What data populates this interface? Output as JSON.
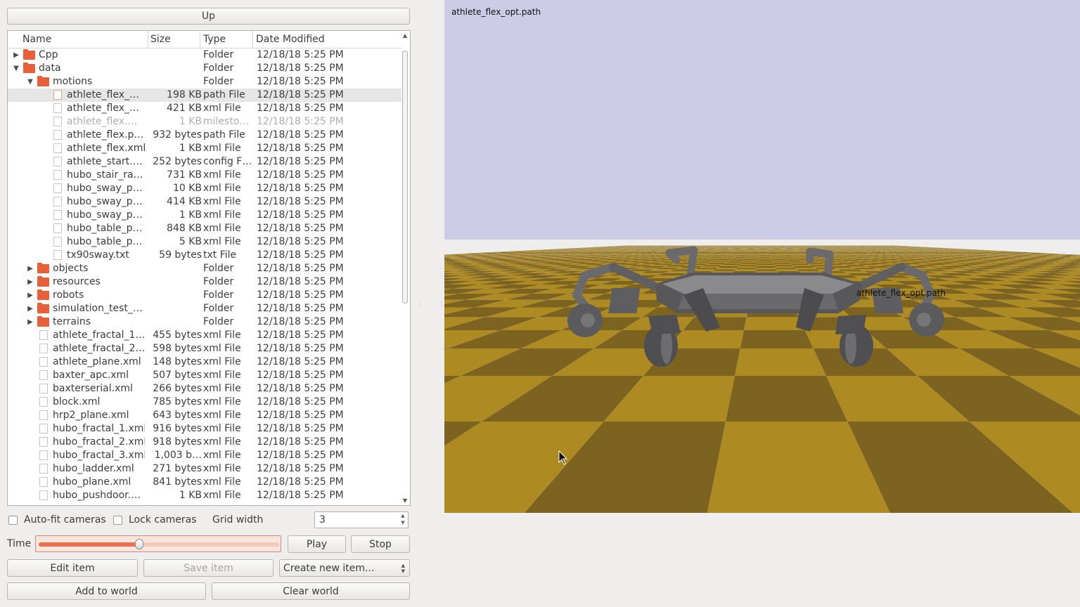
{
  "file_browser": {
    "up_label": "Up",
    "columns": [
      "Name",
      "Size",
      "Type",
      "Date Modified"
    ],
    "rows": [
      {
        "name": "Cpp",
        "size": "",
        "type": "Folder",
        "date": "12/18/18 5:25 PM",
        "depth": 0,
        "kind": "folder",
        "arrow": "collapsed"
      },
      {
        "name": "data",
        "size": "",
        "type": "Folder",
        "date": "12/18/18 5:25 PM",
        "depth": 0,
        "kind": "folder",
        "arrow": "expanded"
      },
      {
        "name": "motions",
        "size": "",
        "type": "Folder",
        "date": "12/18/18 5:25 PM",
        "depth": 1,
        "kind": "folder",
        "arrow": "expanded"
      },
      {
        "name": "athlete_flex_…",
        "size": "198 KB",
        "type": "path File",
        "date": "12/18/18 5:25 PM",
        "depth": 2,
        "kind": "file",
        "selected": true
      },
      {
        "name": "athlete_flex_…",
        "size": "421 KB",
        "type": "xml File",
        "date": "12/18/18 5:25 PM",
        "depth": 2,
        "kind": "file"
      },
      {
        "name": "athlete_flex.…",
        "size": "1 KB",
        "type": "milesto…",
        "date": "12/18/18 5:25 PM",
        "depth": 2,
        "kind": "file",
        "dim": true
      },
      {
        "name": "athlete_flex.p…",
        "size": "932 bytes",
        "type": "path File",
        "date": "12/18/18 5:25 PM",
        "depth": 2,
        "kind": "file"
      },
      {
        "name": "athlete_flex.xml",
        "size": "1 KB",
        "type": "xml File",
        "date": "12/18/18 5:25 PM",
        "depth": 2,
        "kind": "file"
      },
      {
        "name": "athlete_start.…",
        "size": "252 bytes",
        "type": "config F…",
        "date": "12/18/18 5:25 PM",
        "depth": 2,
        "kind": "file"
      },
      {
        "name": "hubo_stair_ra…",
        "size": "731 KB",
        "type": "xml File",
        "date": "12/18/18 5:25 PM",
        "depth": 2,
        "kind": "file"
      },
      {
        "name": "hubo_sway_p…",
        "size": "10 KB",
        "type": "xml File",
        "date": "12/18/18 5:25 PM",
        "depth": 2,
        "kind": "file"
      },
      {
        "name": "hubo_sway_p…",
        "size": "414 KB",
        "type": "xml File",
        "date": "12/18/18 5:25 PM",
        "depth": 2,
        "kind": "file"
      },
      {
        "name": "hubo_sway_p…",
        "size": "1 KB",
        "type": "xml File",
        "date": "12/18/18 5:25 PM",
        "depth": 2,
        "kind": "file"
      },
      {
        "name": "hubo_table_p…",
        "size": "848 KB",
        "type": "xml File",
        "date": "12/18/18 5:25 PM",
        "depth": 2,
        "kind": "file"
      },
      {
        "name": "hubo_table_p…",
        "size": "5 KB",
        "type": "xml File",
        "date": "12/18/18 5:25 PM",
        "depth": 2,
        "kind": "file"
      },
      {
        "name": "tx90sway.txt",
        "size": "59 bytes",
        "type": "txt File",
        "date": "12/18/18 5:25 PM",
        "depth": 2,
        "kind": "file"
      },
      {
        "name": "objects",
        "size": "",
        "type": "Folder",
        "date": "12/18/18 5:25 PM",
        "depth": 1,
        "kind": "folder",
        "arrow": "collapsed"
      },
      {
        "name": "resources",
        "size": "",
        "type": "Folder",
        "date": "12/18/18 5:25 PM",
        "depth": 1,
        "kind": "folder",
        "arrow": "collapsed"
      },
      {
        "name": "robots",
        "size": "",
        "type": "Folder",
        "date": "12/18/18 5:25 PM",
        "depth": 1,
        "kind": "folder",
        "arrow": "collapsed"
      },
      {
        "name": "simulation_test_…",
        "size": "",
        "type": "Folder",
        "date": "12/18/18 5:25 PM",
        "depth": 1,
        "kind": "folder",
        "arrow": "collapsed"
      },
      {
        "name": "terrains",
        "size": "",
        "type": "Folder",
        "date": "12/18/18 5:25 PM",
        "depth": 1,
        "kind": "folder",
        "arrow": "collapsed"
      },
      {
        "name": "athlete_fractal_1…",
        "size": "455 bytes",
        "type": "xml File",
        "date": "12/18/18 5:25 PM",
        "depth": 1,
        "kind": "file"
      },
      {
        "name": "athlete_fractal_2…",
        "size": "598 bytes",
        "type": "xml File",
        "date": "12/18/18 5:25 PM",
        "depth": 1,
        "kind": "file"
      },
      {
        "name": "athlete_plane.xml",
        "size": "148 bytes",
        "type": "xml File",
        "date": "12/18/18 5:25 PM",
        "depth": 1,
        "kind": "file"
      },
      {
        "name": "baxter_apc.xml",
        "size": "507 bytes",
        "type": "xml File",
        "date": "12/18/18 5:25 PM",
        "depth": 1,
        "kind": "file"
      },
      {
        "name": "baxterserial.xml",
        "size": "266 bytes",
        "type": "xml File",
        "date": "12/18/18 5:25 PM",
        "depth": 1,
        "kind": "file"
      },
      {
        "name": "block.xml",
        "size": "785 bytes",
        "type": "xml File",
        "date": "12/18/18 5:25 PM",
        "depth": 1,
        "kind": "file"
      },
      {
        "name": "hrp2_plane.xml",
        "size": "643 bytes",
        "type": "xml File",
        "date": "12/18/18 5:25 PM",
        "depth": 1,
        "kind": "file"
      },
      {
        "name": "hubo_fractal_1.xml",
        "size": "916 bytes",
        "type": "xml File",
        "date": "12/18/18 5:25 PM",
        "depth": 1,
        "kind": "file"
      },
      {
        "name": "hubo_fractal_2.xml",
        "size": "918 bytes",
        "type": "xml File",
        "date": "12/18/18 5:25 PM",
        "depth": 1,
        "kind": "file"
      },
      {
        "name": "hubo_fractal_3.xml",
        "size": "1,003 b…",
        "type": "xml File",
        "date": "12/18/18 5:25 PM",
        "depth": 1,
        "kind": "file"
      },
      {
        "name": "hubo_ladder.xml",
        "size": "271 bytes",
        "type": "xml File",
        "date": "12/18/18 5:25 PM",
        "depth": 1,
        "kind": "file"
      },
      {
        "name": "hubo_plane.xml",
        "size": "841 bytes",
        "type": "xml File",
        "date": "12/18/18 5:25 PM",
        "depth": 1,
        "kind": "file"
      },
      {
        "name": "hubo_pushdoor.…",
        "size": "1 KB",
        "type": "xml File",
        "date": "12/18/18 5:25 PM",
        "depth": 1,
        "kind": "file"
      }
    ]
  },
  "controls": {
    "auto_fit_label": "Auto-fit cameras",
    "lock_cameras_label": "Lock cameras",
    "grid_width_label": "Grid width",
    "grid_width_value": "3",
    "time_label": "Time",
    "time_fraction": 0.42,
    "play_label": "Play",
    "stop_label": "Stop",
    "edit_item_label": "Edit item",
    "save_item_label": "Save item",
    "create_new_label": "Create new item...",
    "add_to_world_label": "Add to world",
    "clear_world_label": "Clear world"
  },
  "viewport": {
    "title": "athlete_flex_opt.path",
    "robot_label": "athlete_flex_opt.path",
    "sky_color": "#cccce6",
    "floor_color_a": "#ae8a22",
    "floor_color_b": "#7c6320",
    "robot_color": "#6e6e70"
  }
}
